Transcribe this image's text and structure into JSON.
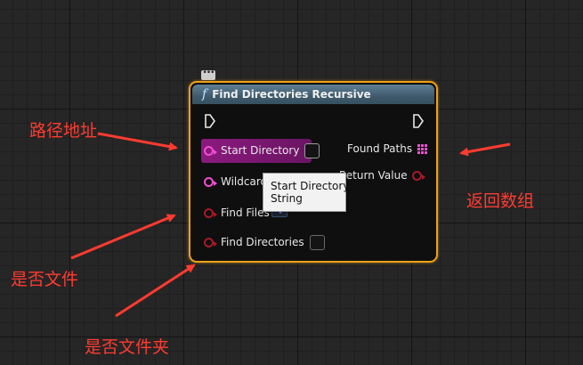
{
  "node": {
    "title": "Find Directories Recursive",
    "inputs": {
      "start_directory": "Start Directory",
      "wildcard": "Wildcard",
      "find_files": "Find Files",
      "find_directories": "Find Directories"
    },
    "outputs": {
      "found_paths": "Found Paths",
      "return_value": "Return Value"
    },
    "icon": "function-icon"
  },
  "tooltip": {
    "line1": "Start Directory",
    "line2": "String"
  },
  "annotations": {
    "path_address": "路径地址",
    "return_array": "返回数组",
    "is_file": "是否文件",
    "is_folder": "是否文件夹"
  },
  "colors": {
    "node_border": "#f0a018",
    "header": "#4a6a80",
    "string_pin": "#f04fd2",
    "bool_pin": "#a51a2a",
    "annotation": "#ff3b30"
  }
}
